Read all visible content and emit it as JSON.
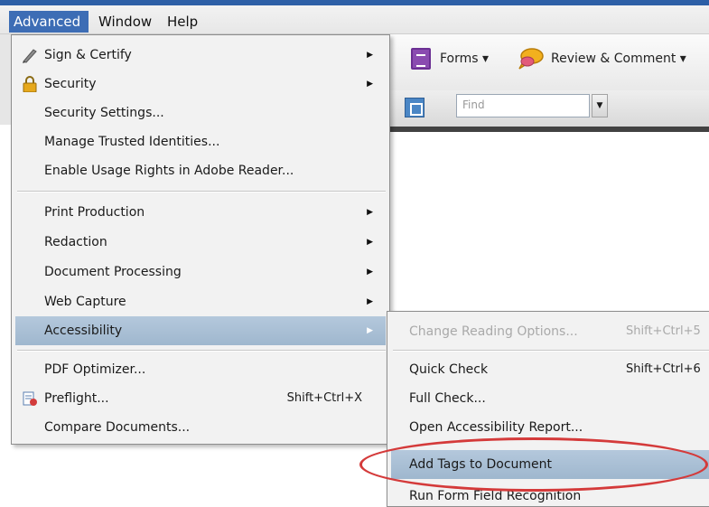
{
  "menubar": {
    "items": [
      {
        "label": "Advanced",
        "active": true
      },
      {
        "label": "Window",
        "active": false
      },
      {
        "label": "Help",
        "active": false
      }
    ]
  },
  "toolbar": {
    "forms_label": "Forms ▾",
    "review_label": "Review & Comment ▾",
    "find_placeholder": "Find"
  },
  "menu": {
    "items": [
      {
        "label": "Sign & Certify",
        "submenu": true,
        "icon": "pen-icon"
      },
      {
        "label": "Security",
        "submenu": true,
        "icon": "lock-icon"
      },
      {
        "label": "Security Settings...",
        "submenu": false
      },
      {
        "label": "Manage Trusted Identities...",
        "submenu": false
      },
      {
        "label": "Enable Usage Rights in Adobe Reader...",
        "submenu": false
      },
      {
        "label": "Print Production",
        "submenu": true
      },
      {
        "label": "Redaction",
        "submenu": true
      },
      {
        "label": "Document Processing",
        "submenu": true
      },
      {
        "label": "Web Capture",
        "submenu": true
      },
      {
        "label": "Accessibility",
        "submenu": true,
        "highlighted": true
      },
      {
        "label": "PDF Optimizer...",
        "submenu": false
      },
      {
        "label": "Preflight...",
        "submenu": false,
        "shortcut": "Shift+Ctrl+X",
        "icon": "preflight-icon"
      },
      {
        "label": "Compare Documents...",
        "submenu": false
      }
    ],
    "arrow": "▶"
  },
  "submenu": {
    "items": [
      {
        "label": "Change Reading Options...",
        "shortcut": "Shift+Ctrl+5",
        "disabled": true
      },
      {
        "label": "Quick Check",
        "shortcut": "Shift+Ctrl+6"
      },
      {
        "label": "Full Check..."
      },
      {
        "label": "Open Accessibility Report..."
      },
      {
        "label": "Add Tags to Document",
        "highlighted": true
      },
      {
        "label": "Run Form Field Recognition"
      }
    ]
  },
  "colors": {
    "menubar_active": "#3d6db5",
    "highlight": "#a9bfd4",
    "annotation_circle": "#d43a3a",
    "forms_icon": "#8a4bb0",
    "review_icon": "#f2b01e"
  }
}
